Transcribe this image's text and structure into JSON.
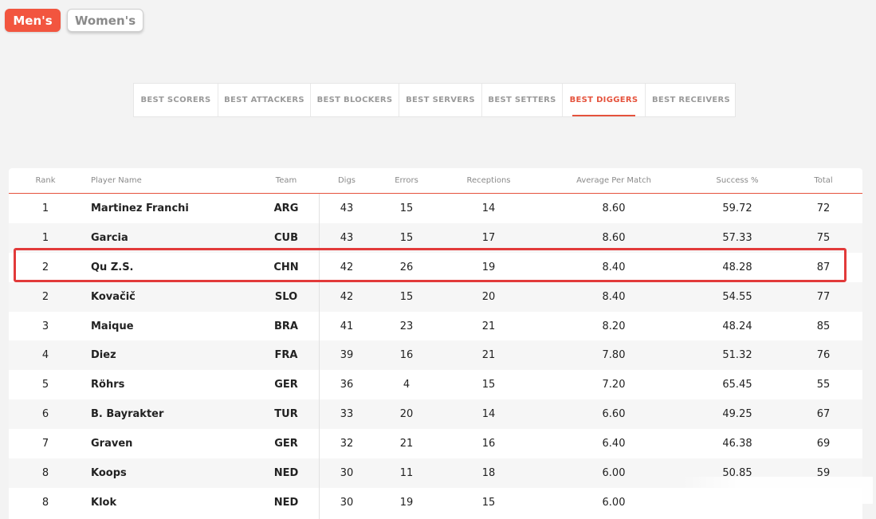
{
  "gender_toggle": {
    "men": "Men's",
    "women": "Women's"
  },
  "tabs": [
    {
      "label": "BEST SCORERS",
      "active": false
    },
    {
      "label": "BEST ATTACKERS",
      "active": false
    },
    {
      "label": "BEST BLOCKERS",
      "active": false
    },
    {
      "label": "BEST SERVERS",
      "active": false
    },
    {
      "label": "BEST SETTERS",
      "active": false
    },
    {
      "label": "BEST DIGGERS",
      "active": true
    },
    {
      "label": "BEST RECEIVERS",
      "active": false
    }
  ],
  "table": {
    "headers": [
      "Rank",
      "Player Name",
      "Team",
      "Digs",
      "Errors",
      "Receptions",
      "Average Per Match",
      "Success %",
      "Total"
    ],
    "rows": [
      [
        "1",
        "Martinez Franchi",
        "ARG",
        "43",
        "15",
        "14",
        "8.60",
        "59.72",
        "72"
      ],
      [
        "1",
        "Garcia",
        "CUB",
        "43",
        "15",
        "17",
        "8.60",
        "57.33",
        "75"
      ],
      [
        "2",
        "Qu Z.S.",
        "CHN",
        "42",
        "26",
        "19",
        "8.40",
        "48.28",
        "87"
      ],
      [
        "2",
        "Kovačič",
        "SLO",
        "42",
        "15",
        "20",
        "8.40",
        "54.55",
        "77"
      ],
      [
        "3",
        "Maique",
        "BRA",
        "41",
        "23",
        "21",
        "8.20",
        "48.24",
        "85"
      ],
      [
        "4",
        "Diez",
        "FRA",
        "39",
        "16",
        "21",
        "7.80",
        "51.32",
        "76"
      ],
      [
        "5",
        "Röhrs",
        "GER",
        "36",
        "4",
        "15",
        "7.20",
        "65.45",
        "55"
      ],
      [
        "6",
        "B. Bayrakter",
        "TUR",
        "33",
        "20",
        "14",
        "6.60",
        "49.25",
        "67"
      ],
      [
        "7",
        "Graven",
        "GER",
        "32",
        "21",
        "16",
        "6.40",
        "46.38",
        "69"
      ],
      [
        "8",
        "Koops",
        "NED",
        "30",
        "11",
        "18",
        "6.00",
        "50.85",
        "59"
      ],
      [
        "8",
        "Klok",
        "NED",
        "30",
        "19",
        "15",
        "6.00",
        "",
        ""
      ]
    ]
  },
  "colors": {
    "accent": "#e5533d",
    "highlight": "#e23a3a",
    "toggle_active": "#f2553f"
  }
}
